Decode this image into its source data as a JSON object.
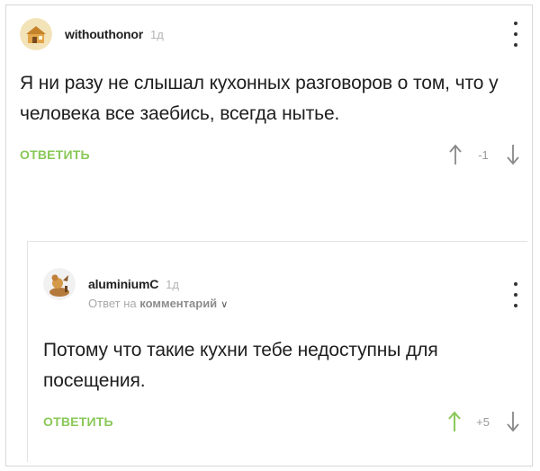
{
  "comments": [
    {
      "username": "withouthonor",
      "time": "1д",
      "text": "Я ни разу не слышал кухонных разговоров о том, что у человека все заебись, всегда нытье.",
      "reply_label": "ОТВЕТИТЬ",
      "score": "-1",
      "upvoted": false
    },
    {
      "username": "aluminiumC",
      "time": "1д",
      "reply_to_prefix": "Ответ на",
      "reply_to_link": "комментарий",
      "text": "Потому что такие кухни тебе недоступны для посещения.",
      "reply_label": "ОТВЕТИТЬ",
      "score": "+5",
      "upvoted": true
    }
  ],
  "colors": {
    "accent_green": "#8ac858",
    "muted_text": "#a9a9a9",
    "arrow_default": "#888888"
  },
  "icons": {
    "menu": "kebab-menu-icon",
    "upvote": "arrow-up-icon",
    "downvote": "arrow-down-icon",
    "reply_chevron": "chevron-down-icon"
  }
}
